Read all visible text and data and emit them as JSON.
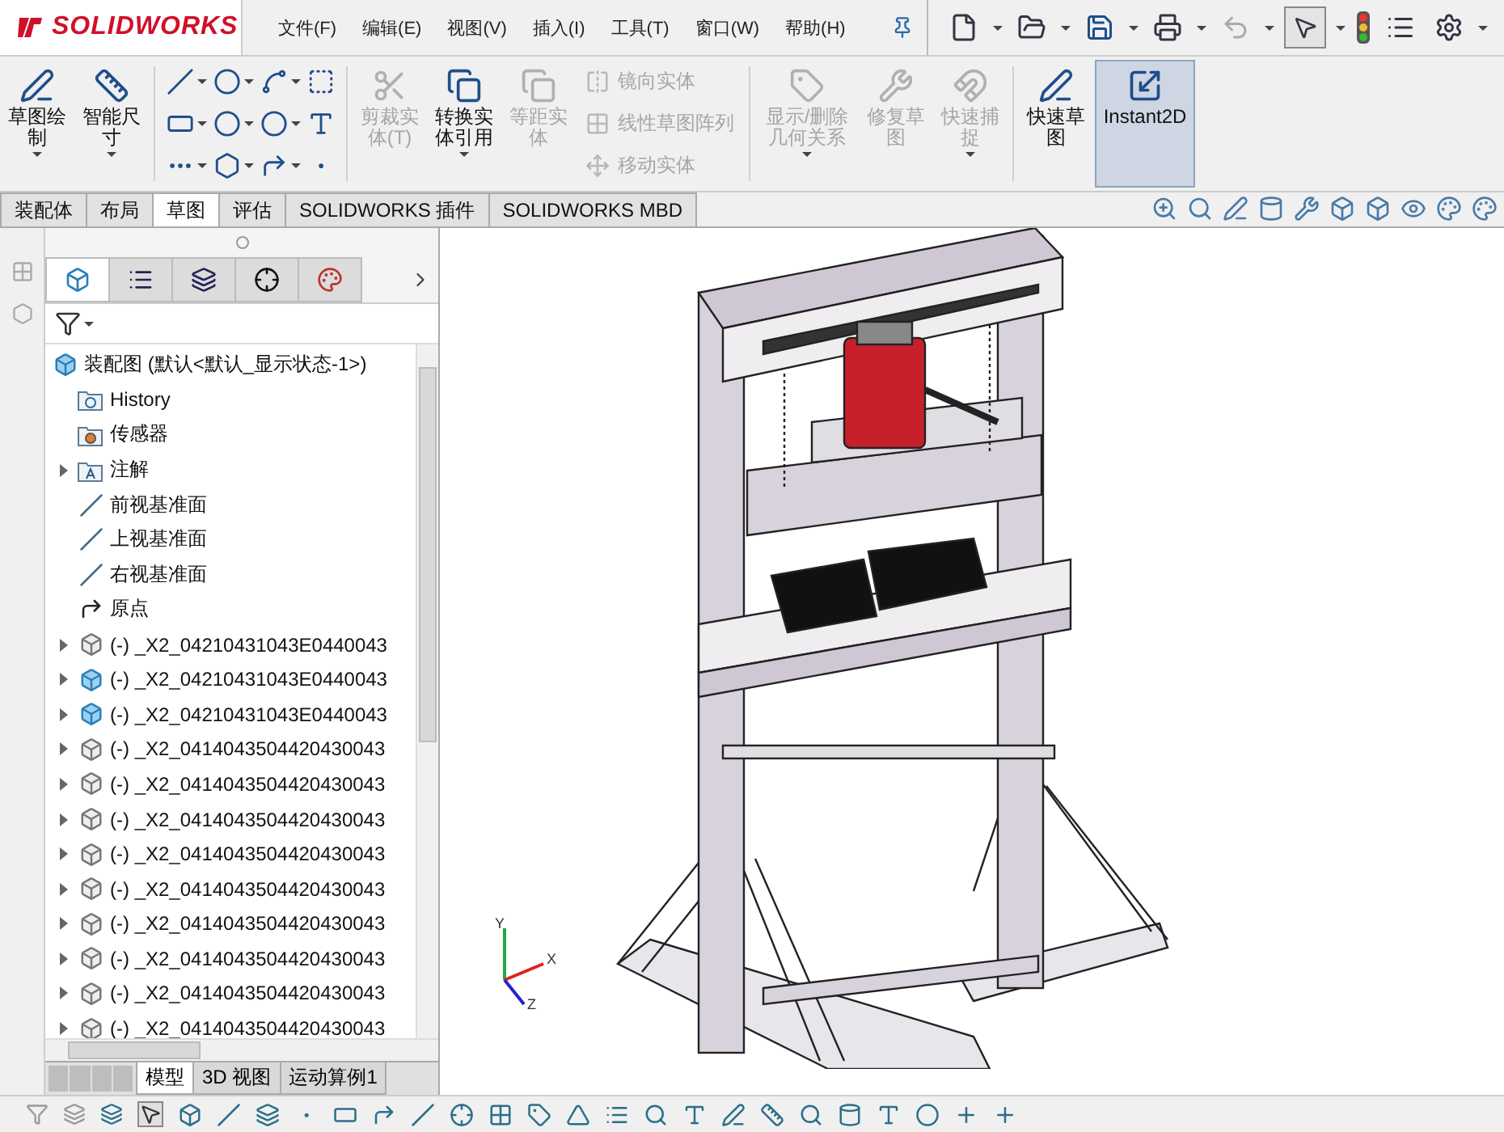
{
  "app": {
    "logo": "SOLIDWORKS"
  },
  "menu": [
    {
      "label": "文件(F)"
    },
    {
      "label": "编辑(E)"
    },
    {
      "label": "视图(V)"
    },
    {
      "label": "插入(I)"
    },
    {
      "label": "工具(T)"
    },
    {
      "label": "窗口(W)"
    },
    {
      "label": "帮助(H)"
    }
  ],
  "ribbon": [
    {
      "kind": "big",
      "label": "草图绘制",
      "disabled": false,
      "selected": false,
      "caret": true
    },
    {
      "kind": "big",
      "label": "智能尺寸",
      "disabled": false,
      "selected": false,
      "caret": true
    },
    {
      "kind": "tools"
    },
    {
      "kind": "big",
      "label": "剪裁实体(T)",
      "disabled": true,
      "selected": false,
      "caret": false
    },
    {
      "kind": "big",
      "label": "转换实体引用",
      "disabled": false,
      "selected": false,
      "caret": true
    },
    {
      "kind": "big",
      "label": "等距实体",
      "disabled": true,
      "selected": false,
      "caret": false
    },
    {
      "kind": "stack",
      "items": [
        {
          "label": "镜向实体",
          "disabled": true
        },
        {
          "label": "线性草图阵列",
          "disabled": true
        },
        {
          "label": "移动实体",
          "disabled": true
        }
      ]
    },
    {
      "kind": "big",
      "label": "显示/删除几何关系",
      "disabled": true,
      "selected": false,
      "caret": true
    },
    {
      "kind": "big",
      "label": "修复草图",
      "disabled": true,
      "selected": false,
      "caret": false
    },
    {
      "kind": "big",
      "label": "快速捕捉",
      "disabled": true,
      "selected": false,
      "caret": true
    },
    {
      "kind": "big",
      "label": "快速草图",
      "disabled": false,
      "selected": false,
      "caret": false
    },
    {
      "kind": "big",
      "label": "Instant2D",
      "disabled": false,
      "selected": true,
      "caret": false
    }
  ],
  "command_tabs": [
    {
      "label": "装配体",
      "selected": false
    },
    {
      "label": "布局",
      "selected": false
    },
    {
      "label": "草图",
      "selected": true
    },
    {
      "label": "评估",
      "selected": false
    },
    {
      "label": "SOLIDWORKS 插件",
      "selected": false
    },
    {
      "label": "SOLIDWORKS MBD",
      "selected": false
    }
  ],
  "panel_tabs": [
    {
      "kind": "feature",
      "selected": true
    },
    {
      "kind": "property",
      "selected": false
    },
    {
      "kind": "config",
      "selected": false
    },
    {
      "kind": "dimxpert",
      "selected": false
    },
    {
      "kind": "display",
      "selected": false
    }
  ],
  "tree": {
    "label": "装配图  (默认<默认_显示状态-1>)",
    "kind": "assembly",
    "children": [
      {
        "label": "History",
        "kind": "history"
      },
      {
        "label": "传感器",
        "kind": "sensor"
      },
      {
        "label": "注解",
        "kind": "annotation",
        "expanded": false
      },
      {
        "label": "前视基准面",
        "kind": "plane"
      },
      {
        "label": "上视基准面",
        "kind": "plane"
      },
      {
        "label": "右视基准面",
        "kind": "plane"
      },
      {
        "label": "原点",
        "kind": "origin"
      },
      {
        "label": "(-) _X2_04210431043E0440043",
        "kind": "part",
        "expanded": false
      },
      {
        "label": "(-) _X2_04210431043E0440043",
        "kind": "assembly",
        "expanded": false
      },
      {
        "label": "(-) _X2_04210431043E0440043",
        "kind": "assembly",
        "expanded": false
      },
      {
        "label": "(-) _X2_0414043504420430043",
        "kind": "part",
        "expanded": false
      },
      {
        "label": "(-) _X2_0414043504420430043",
        "kind": "part",
        "expanded": false
      },
      {
        "label": "(-) _X2_0414043504420430043",
        "kind": "part",
        "expanded": false
      },
      {
        "label": "(-) _X2_0414043504420430043",
        "kind": "part",
        "expanded": false
      },
      {
        "label": "(-) _X2_0414043504420430043",
        "kind": "part",
        "expanded": false
      },
      {
        "label": "(-) _X2_0414043504420430043",
        "kind": "part",
        "expanded": false
      },
      {
        "label": "(-) _X2_0414043504420430043",
        "kind": "part",
        "expanded": false
      },
      {
        "label": "(-) _X2_0414043504420430043",
        "kind": "part",
        "expanded": false
      },
      {
        "label": "(-) _X2_0414043504420430043",
        "kind": "part",
        "expanded": false
      }
    ]
  },
  "bottom_tabs": [
    {
      "label": "模型",
      "selected": true
    },
    {
      "label": "3D 视图",
      "selected": false
    },
    {
      "label": "运动算例1",
      "selected": false
    }
  ],
  "triad": {
    "labels": [
      "Y",
      "X",
      "Z"
    ]
  }
}
